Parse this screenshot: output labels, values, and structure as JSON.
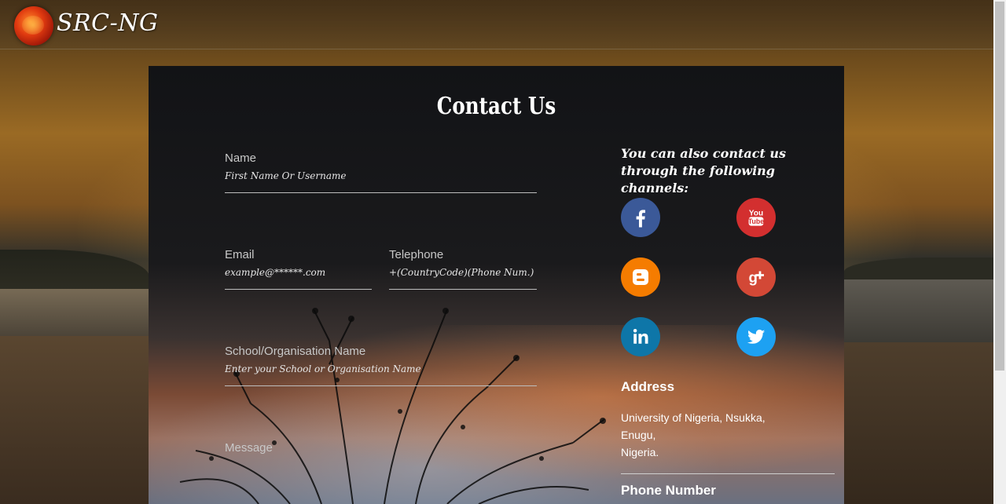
{
  "header": {
    "brand": "SRC-NG"
  },
  "page": {
    "title": "Contact Us"
  },
  "form": {
    "name": {
      "label": "Name",
      "placeholder": "First Name Or Username",
      "value": ""
    },
    "email": {
      "label": "Email",
      "placeholder": "example@******.com",
      "value": ""
    },
    "telephone": {
      "label": "Telephone",
      "placeholder": "+(CountryCode)(Phone Num.)",
      "value": ""
    },
    "school": {
      "label": "School/Organisation Name",
      "placeholder": "Enter your School or Organisation Name",
      "value": ""
    },
    "message": {
      "label": "Message"
    }
  },
  "sidebar": {
    "heading": "You can also contact us through the following channels:",
    "socials": [
      {
        "name": "facebook",
        "icon": "facebook-icon",
        "color": "#3b5998"
      },
      {
        "name": "youtube",
        "icon": "youtube-icon",
        "color": "#d32f2f"
      },
      {
        "name": "blogger",
        "icon": "blogger-icon",
        "color": "#f57c00"
      },
      {
        "name": "google-plus",
        "icon": "google-plus-icon",
        "color": "#d34836"
      },
      {
        "name": "linkedin",
        "icon": "linkedin-icon",
        "color": "#0e76a8"
      },
      {
        "name": "twitter",
        "icon": "twitter-icon",
        "color": "#1da1f2"
      }
    ],
    "address": {
      "title": "Address",
      "lines": [
        "University of Nigeria, Nsukka,",
        "Enugu,",
        "Nigeria."
      ]
    },
    "phone": {
      "title": "Phone Number"
    }
  }
}
